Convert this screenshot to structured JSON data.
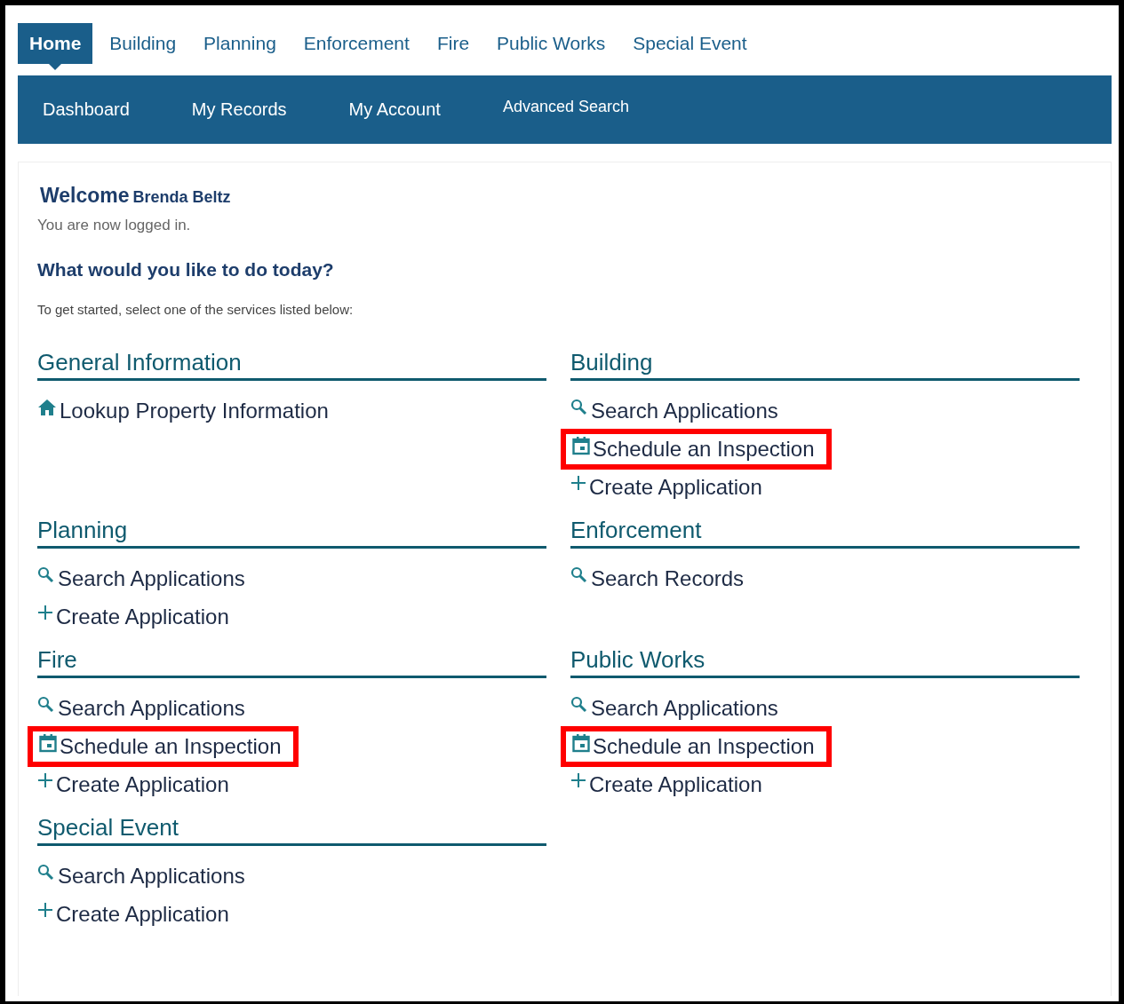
{
  "top_tabs": [
    {
      "label": "Home",
      "selected": true
    },
    {
      "label": "Building",
      "selected": false
    },
    {
      "label": "Planning",
      "selected": false
    },
    {
      "label": "Enforcement",
      "selected": false
    },
    {
      "label": "Fire",
      "selected": false
    },
    {
      "label": "Public Works",
      "selected": false
    },
    {
      "label": "Special Event",
      "selected": false
    }
  ],
  "sub_nav": [
    {
      "label": "Dashboard"
    },
    {
      "label": "My Records"
    },
    {
      "label": "My Account"
    },
    {
      "label": "Advanced Search"
    }
  ],
  "welcome": {
    "greeting": "Welcome",
    "name": "Brenda Beltz",
    "status": "You are now logged in."
  },
  "question": "What would you like to do today?",
  "instructions": "To get started, select one of the services listed below:",
  "sections": [
    {
      "title": "General Information",
      "links": [
        {
          "kind": "home",
          "label": "Lookup Property Information",
          "highlighted": false
        }
      ]
    },
    {
      "title": "Building",
      "links": [
        {
          "kind": "search",
          "label": "Search Applications",
          "highlighted": false
        },
        {
          "kind": "schedule",
          "label": "Schedule an Inspection",
          "highlighted": true
        },
        {
          "kind": "create",
          "label": "Create Application",
          "highlighted": false
        }
      ]
    },
    {
      "title": "Planning",
      "links": [
        {
          "kind": "search",
          "label": "Search Applications",
          "highlighted": false
        },
        {
          "kind": "create",
          "label": "Create Application",
          "highlighted": false
        }
      ]
    },
    {
      "title": "Enforcement",
      "links": [
        {
          "kind": "search",
          "label": "Search Records",
          "highlighted": false
        }
      ]
    },
    {
      "title": "Fire",
      "links": [
        {
          "kind": "search",
          "label": "Search Applications",
          "highlighted": false
        },
        {
          "kind": "schedule",
          "label": "Schedule an Inspection",
          "highlighted": true
        },
        {
          "kind": "create",
          "label": "Create Application",
          "highlighted": false
        }
      ]
    },
    {
      "title": "Public Works",
      "links": [
        {
          "kind": "search",
          "label": "Search Applications",
          "highlighted": false
        },
        {
          "kind": "schedule",
          "label": "Schedule an Inspection",
          "highlighted": true
        },
        {
          "kind": "create",
          "label": "Create Application",
          "highlighted": false
        }
      ]
    },
    {
      "title": "Special Event",
      "links": [
        {
          "kind": "search",
          "label": "Search Applications",
          "highlighted": false
        },
        {
          "kind": "create",
          "label": "Create Application",
          "highlighted": false
        }
      ]
    }
  ]
}
